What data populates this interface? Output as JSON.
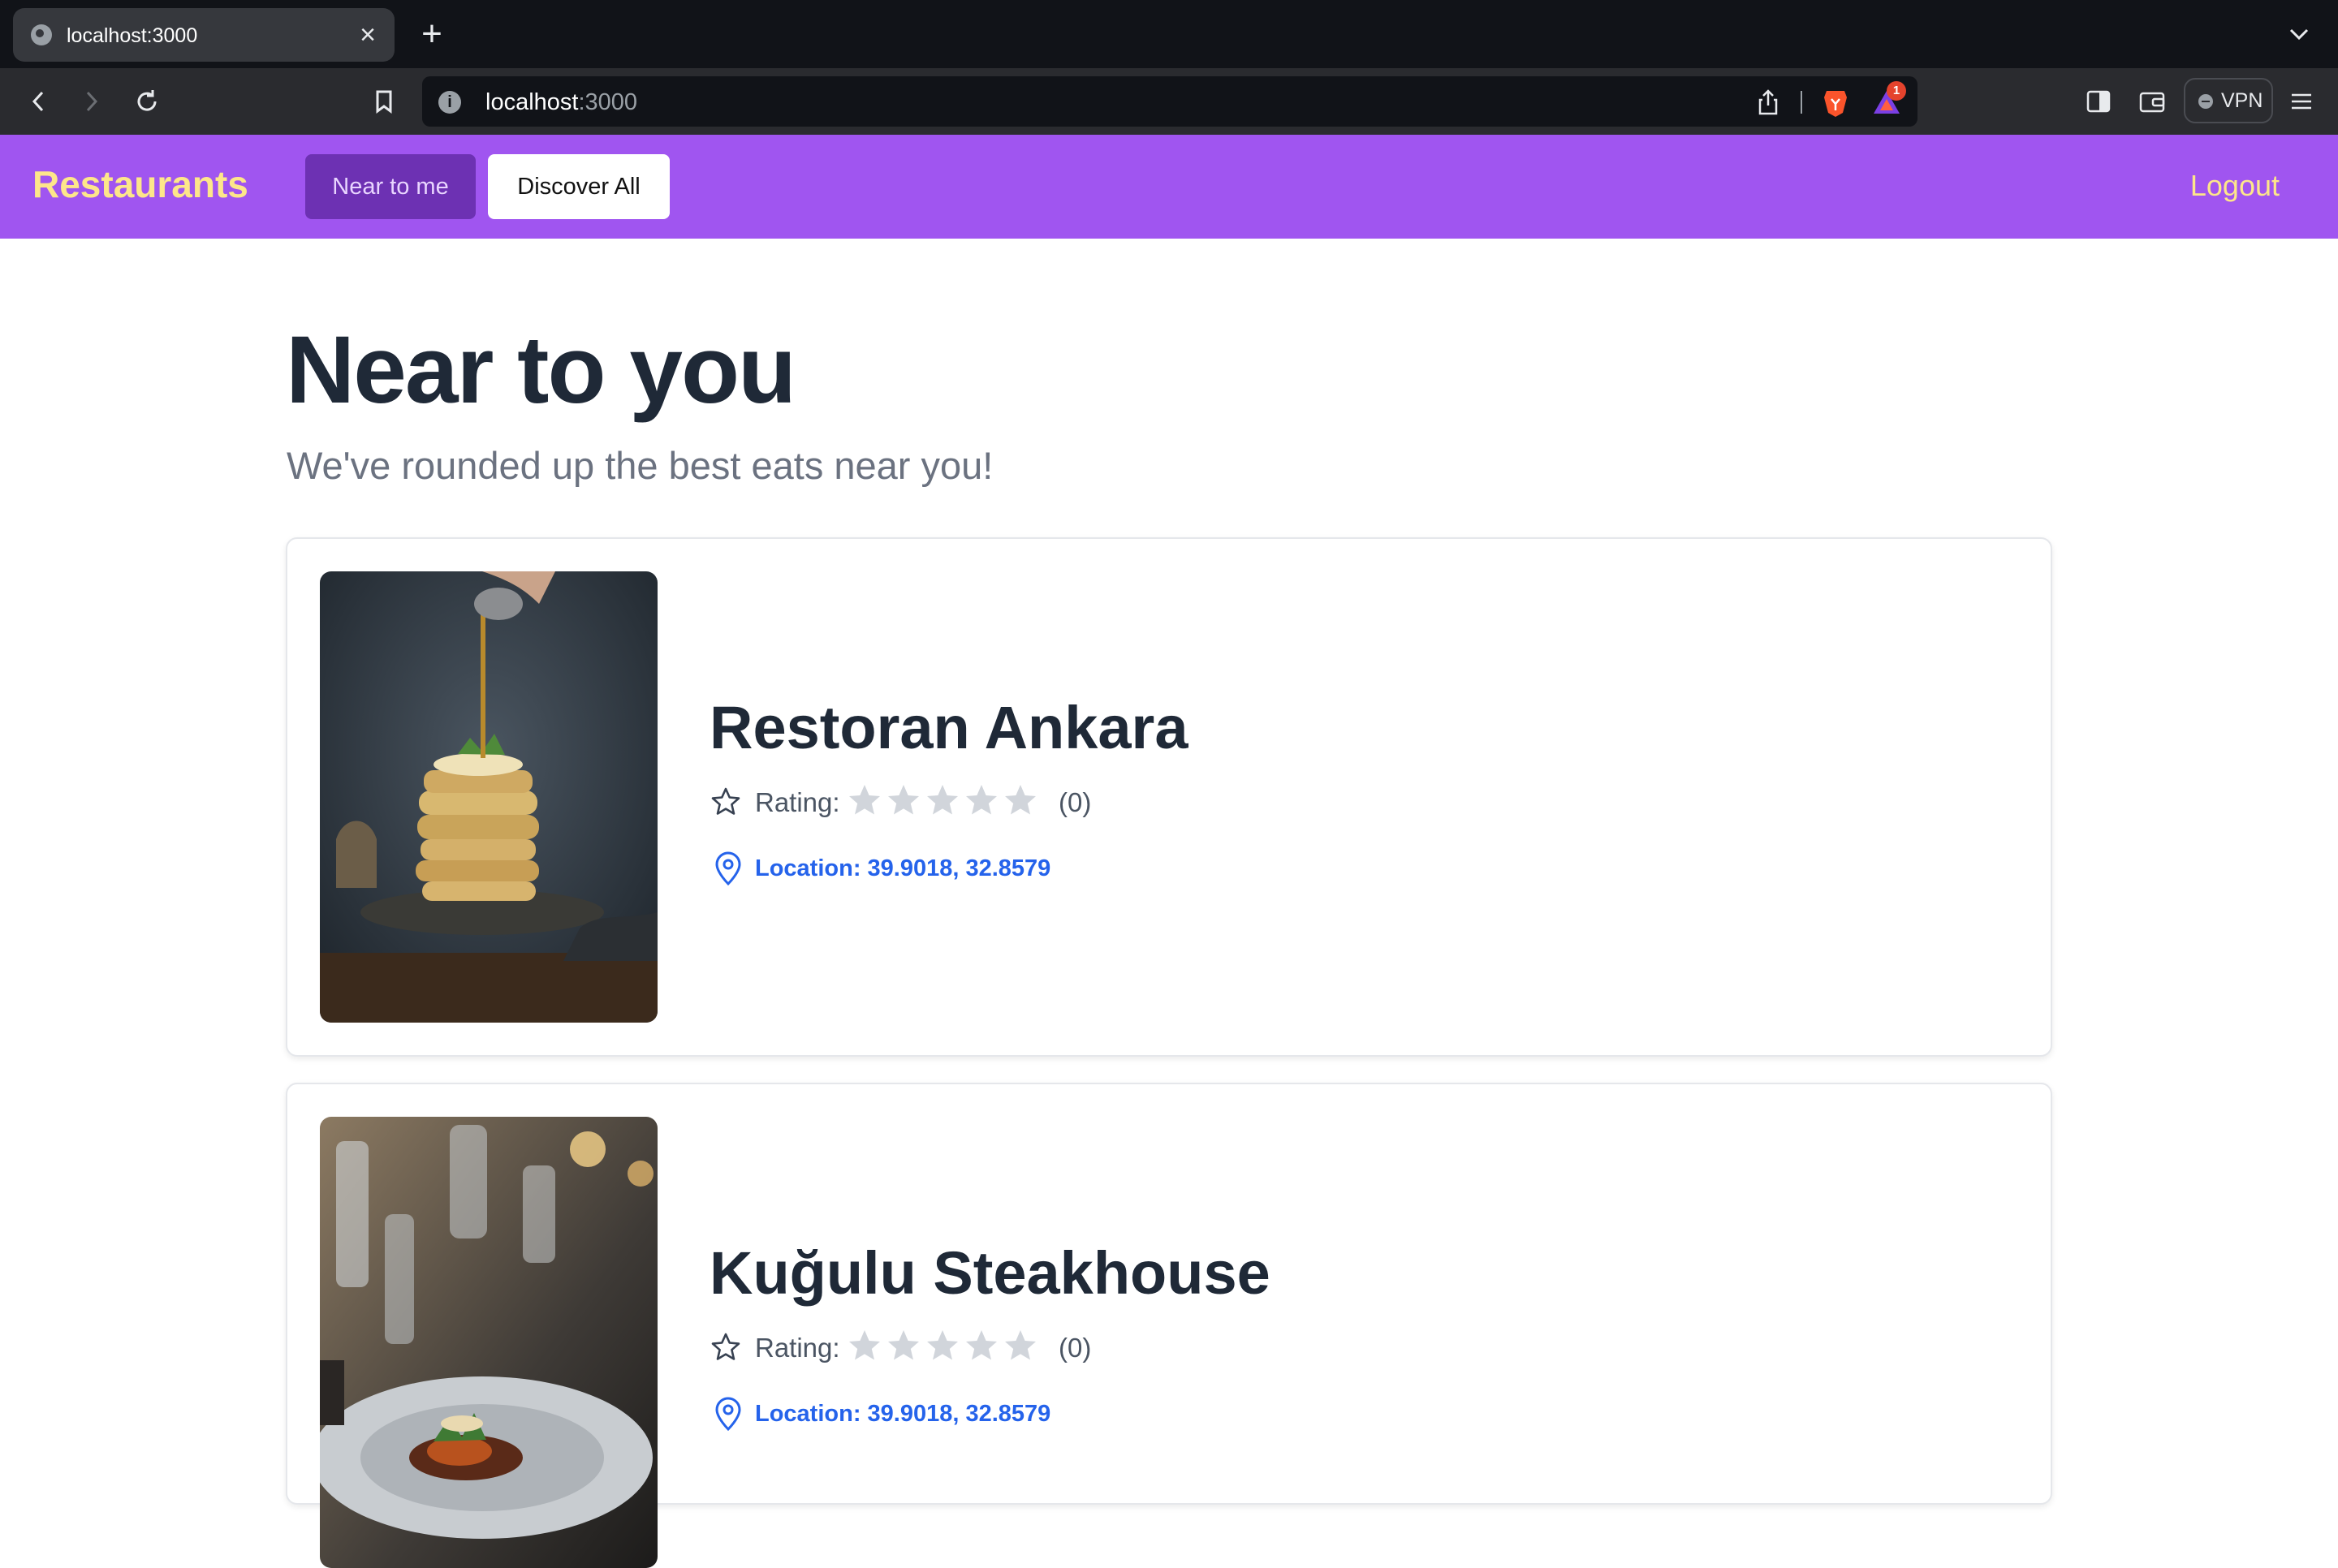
{
  "browser": {
    "tab_title": "localhost:3000",
    "url_host": "localhost",
    "url_port": ":3000",
    "rewards_badge": "1",
    "vpn_label": "VPN"
  },
  "navbar": {
    "brand": "Restaurants",
    "near_button": "Near to me",
    "discover_button": "Discover All",
    "logout": "Logout"
  },
  "page": {
    "title": "Near to you",
    "subtitle": "We've rounded up the best eats near you!"
  },
  "restaurants": [
    {
      "name": "Restoran Ankara",
      "rating_label": "Rating:",
      "rating_value": 0,
      "rating_count": "(0)",
      "location": "Location: 39.9018, 32.8579"
    },
    {
      "name": "Kuğulu Steakhouse",
      "rating_label": "Rating:",
      "rating_value": 0,
      "rating_count": "(0)",
      "location": "Location: 39.9018, 32.8579"
    }
  ],
  "colors": {
    "navbar_bg": "#a055f0",
    "brand": "#fde68a",
    "near_button_bg": "#6d31b3",
    "location_link": "#2563eb",
    "star_empty": "#d1d5db"
  }
}
